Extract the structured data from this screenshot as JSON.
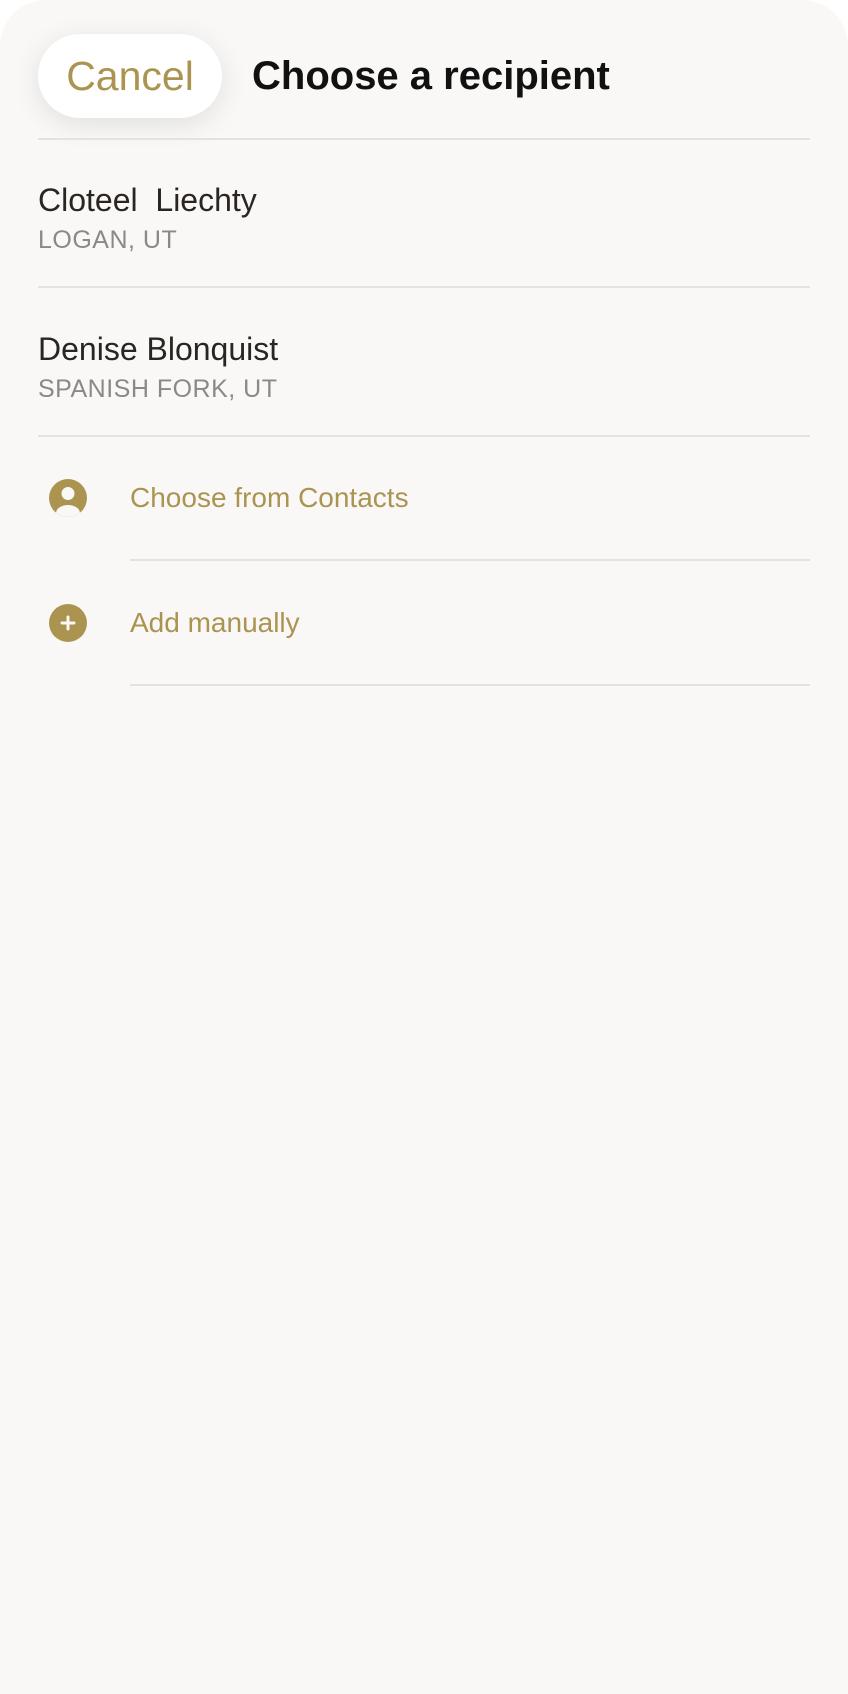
{
  "header": {
    "cancel_label": "Cancel",
    "title": "Choose a recipient"
  },
  "recipients": [
    {
      "name": "Cloteel  Liechty",
      "location": "LOGAN, UT"
    },
    {
      "name": "Denise Blonquist",
      "location": "SPANISH FORK, UT"
    }
  ],
  "actions": [
    {
      "label": "Choose from Contacts",
      "icon": "person-icon"
    },
    {
      "label": "Add manually",
      "icon": "plus-icon"
    }
  ],
  "colors": {
    "accent": "#ab9450",
    "background": "#f9f8f6",
    "divider": "#e4e2dd",
    "primary_text": "#2a2520",
    "secondary_text": "#8c8985"
  }
}
